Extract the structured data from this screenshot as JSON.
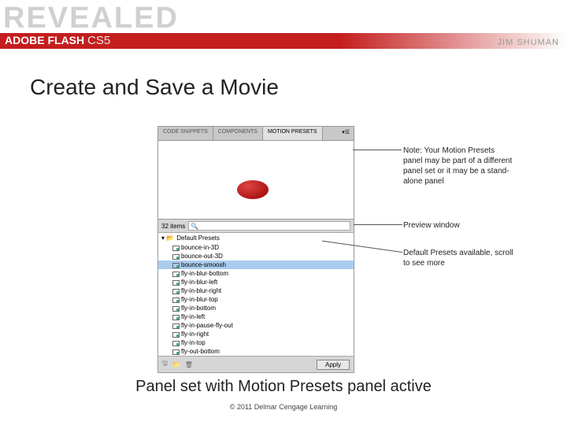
{
  "header": {
    "brand_word": "REVEALED",
    "product_prefix": "ADOBE",
    "product_name": "FLASH",
    "version": "CS5",
    "author": "JIM SHUMAN"
  },
  "title": "Create and Save a Movie",
  "panel": {
    "tabs": [
      {
        "label": "CODE SNIPPETS"
      },
      {
        "label": "COMPONENTS"
      },
      {
        "label": "MOTION PRESETS"
      }
    ],
    "items_count_label": "32 items",
    "folder_label": "Default Presets",
    "presets": [
      "bounce-in-3D",
      "bounce-out-3D",
      "bounce-smoosh",
      "fly-in-blur-bottom",
      "fly-in-blur-left",
      "fly-in-blur-right",
      "fly-in-blur-top",
      "fly-in-bottom",
      "fly-in-left",
      "fly-in-pause-fly-out",
      "fly-in-right",
      "fly-in-top",
      "fly-out-bottom"
    ],
    "selected_index": 2,
    "apply_label": "Apply"
  },
  "callouts": {
    "note": "Note: Your Motion Presets panel may be part of a different panel set or it may be a stand-alone panel",
    "preview": "Preview window",
    "defaults": "Default Presets available, scroll to see more"
  },
  "caption": "Panel set with Motion Presets panel active",
  "copyright": "© 2011 Delmar Cengage Learning"
}
